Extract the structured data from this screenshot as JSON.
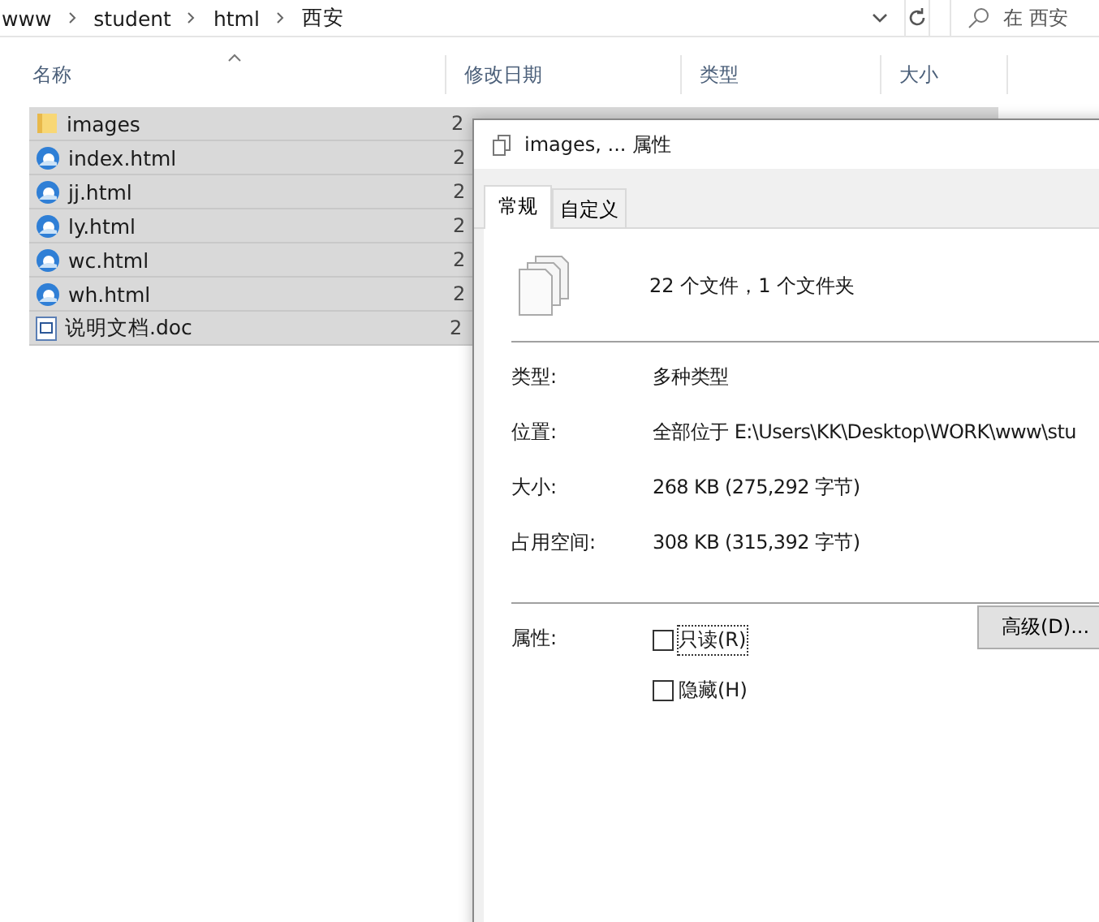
{
  "address_bar": {
    "crumbs": [
      "www",
      "student",
      "html",
      "西安"
    ],
    "search_placeholder": "在 西安"
  },
  "columns": [
    {
      "label": "名称",
      "sorted": true
    },
    {
      "label": "修改日期",
      "sorted": false
    },
    {
      "label": "类型",
      "sorted": false
    },
    {
      "label": "大小",
      "sorted": false
    }
  ],
  "files": [
    {
      "name": "images",
      "kind": "folder",
      "date": "2",
      "selected": true
    },
    {
      "name": "index.html",
      "kind": "html",
      "date": "2",
      "selected": true
    },
    {
      "name": "jj.html",
      "kind": "html",
      "date": "2",
      "selected": true
    },
    {
      "name": "ly.html",
      "kind": "html",
      "date": "2",
      "selected": true
    },
    {
      "name": "wc.html",
      "kind": "html",
      "date": "2",
      "selected": true
    },
    {
      "name": "wh.html",
      "kind": "html",
      "date": "2",
      "selected": true
    },
    {
      "name": "说明文档.doc",
      "kind": "doc",
      "date": "2",
      "selected": true
    }
  ],
  "dialog": {
    "title": "images, ... 属性",
    "tabs": [
      {
        "label": "常规",
        "selected": true
      },
      {
        "label": "自定义",
        "selected": false
      }
    ],
    "summary": "22 个文件，1 个文件夹",
    "props": [
      {
        "label": "类型:",
        "value": "多种类型"
      },
      {
        "label": "位置:",
        "value": "全部位于 E:\\Users\\KK\\Desktop\\WORK\\www\\stu"
      },
      {
        "label": "大小:",
        "value": "268 KB (275,292 字节)"
      },
      {
        "label": "占用空间:",
        "value": "308 KB (315,392 字节)"
      }
    ],
    "attributes_label": "属性:",
    "checkboxes": [
      {
        "label": "只读(R)",
        "checked": false,
        "focused": true
      },
      {
        "label": "隐藏(H)",
        "checked": false,
        "focused": false
      }
    ],
    "advanced_button": "高级(D)..."
  }
}
